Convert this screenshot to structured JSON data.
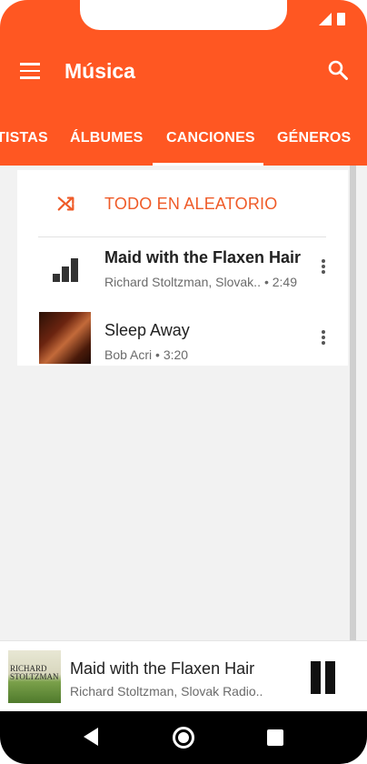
{
  "app": {
    "title": "Música",
    "accent_color": "#ff5722",
    "shuffle_color": "#ef5b28"
  },
  "header": {
    "menu_icon": "menu-icon",
    "search_icon": "search-icon"
  },
  "tabs": [
    {
      "label": "TISTAS"
    },
    {
      "label": "ÁLBUMES"
    },
    {
      "label": "CANCIONES",
      "active": true
    },
    {
      "label": "GÉNEROS"
    }
  ],
  "shuffle": {
    "label": "TODO EN ALEATORIO",
    "icon": "shuffle-icon"
  },
  "songs": [
    {
      "title": "Maid with the Flaxen Hair",
      "subtitle": "Richard Stoltzman, Slovak..",
      "duration": "• 2:49",
      "playing": true,
      "icon": "equalizer-bars-icon"
    },
    {
      "title": "Sleep Away",
      "subtitle": "Bob Acri • 3:20",
      "playing": false,
      "icon": "album-art"
    }
  ],
  "now_playing": {
    "title": "Maid with the Flaxen Hair",
    "subtitle": "Richard Stoltzman, Slovak Radio..",
    "album_text": "RICHARD STOLTZMAN",
    "control": "pause-icon"
  },
  "nav": {
    "back": "back-icon",
    "home": "home-icon",
    "recent": "recent-apps-icon"
  }
}
